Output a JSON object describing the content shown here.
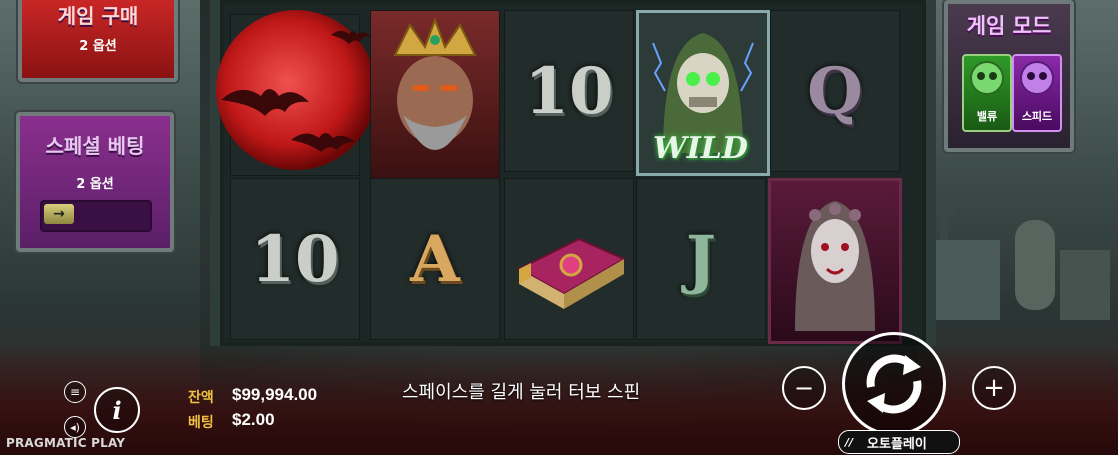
{
  "game": {
    "provider": "PRAGMATIC PLAY",
    "hint": "스페이스를 길게 눌러 터보 스핀"
  },
  "left_panels": {
    "top": {
      "title": "게임 구매",
      "option": "2 옵션"
    },
    "special_bet": {
      "title": "스페셜 베팅",
      "option": "2 옵션"
    }
  },
  "game_mode": {
    "title": "게임 모드",
    "value_label": "밸류",
    "speed_label": "스피드"
  },
  "reels": {
    "row1": [
      "blood-moon",
      "king",
      "10",
      "wild-reaper",
      "Q"
    ],
    "row2": [
      "10",
      "A",
      "spellbook",
      "J",
      "vampire-bride"
    ]
  },
  "symbols": {
    "ten": "10",
    "queen": "Q",
    "ace": "A",
    "jack": "J",
    "wild": "WILD"
  },
  "wallet": {
    "balance_label": "잔액",
    "balance_value": "$99,994.00",
    "bet_label": "베팅",
    "bet_value": "$2.00"
  },
  "controls": {
    "autoplay_label": "오토플레이",
    "minus": "−",
    "plus": "+",
    "info": "i"
  },
  "colors": {
    "accent_gold": "#f0c040",
    "panel_purple": "#7a2a86",
    "panel_red": "#c0202a",
    "mode_green": "#2f8a2a"
  }
}
